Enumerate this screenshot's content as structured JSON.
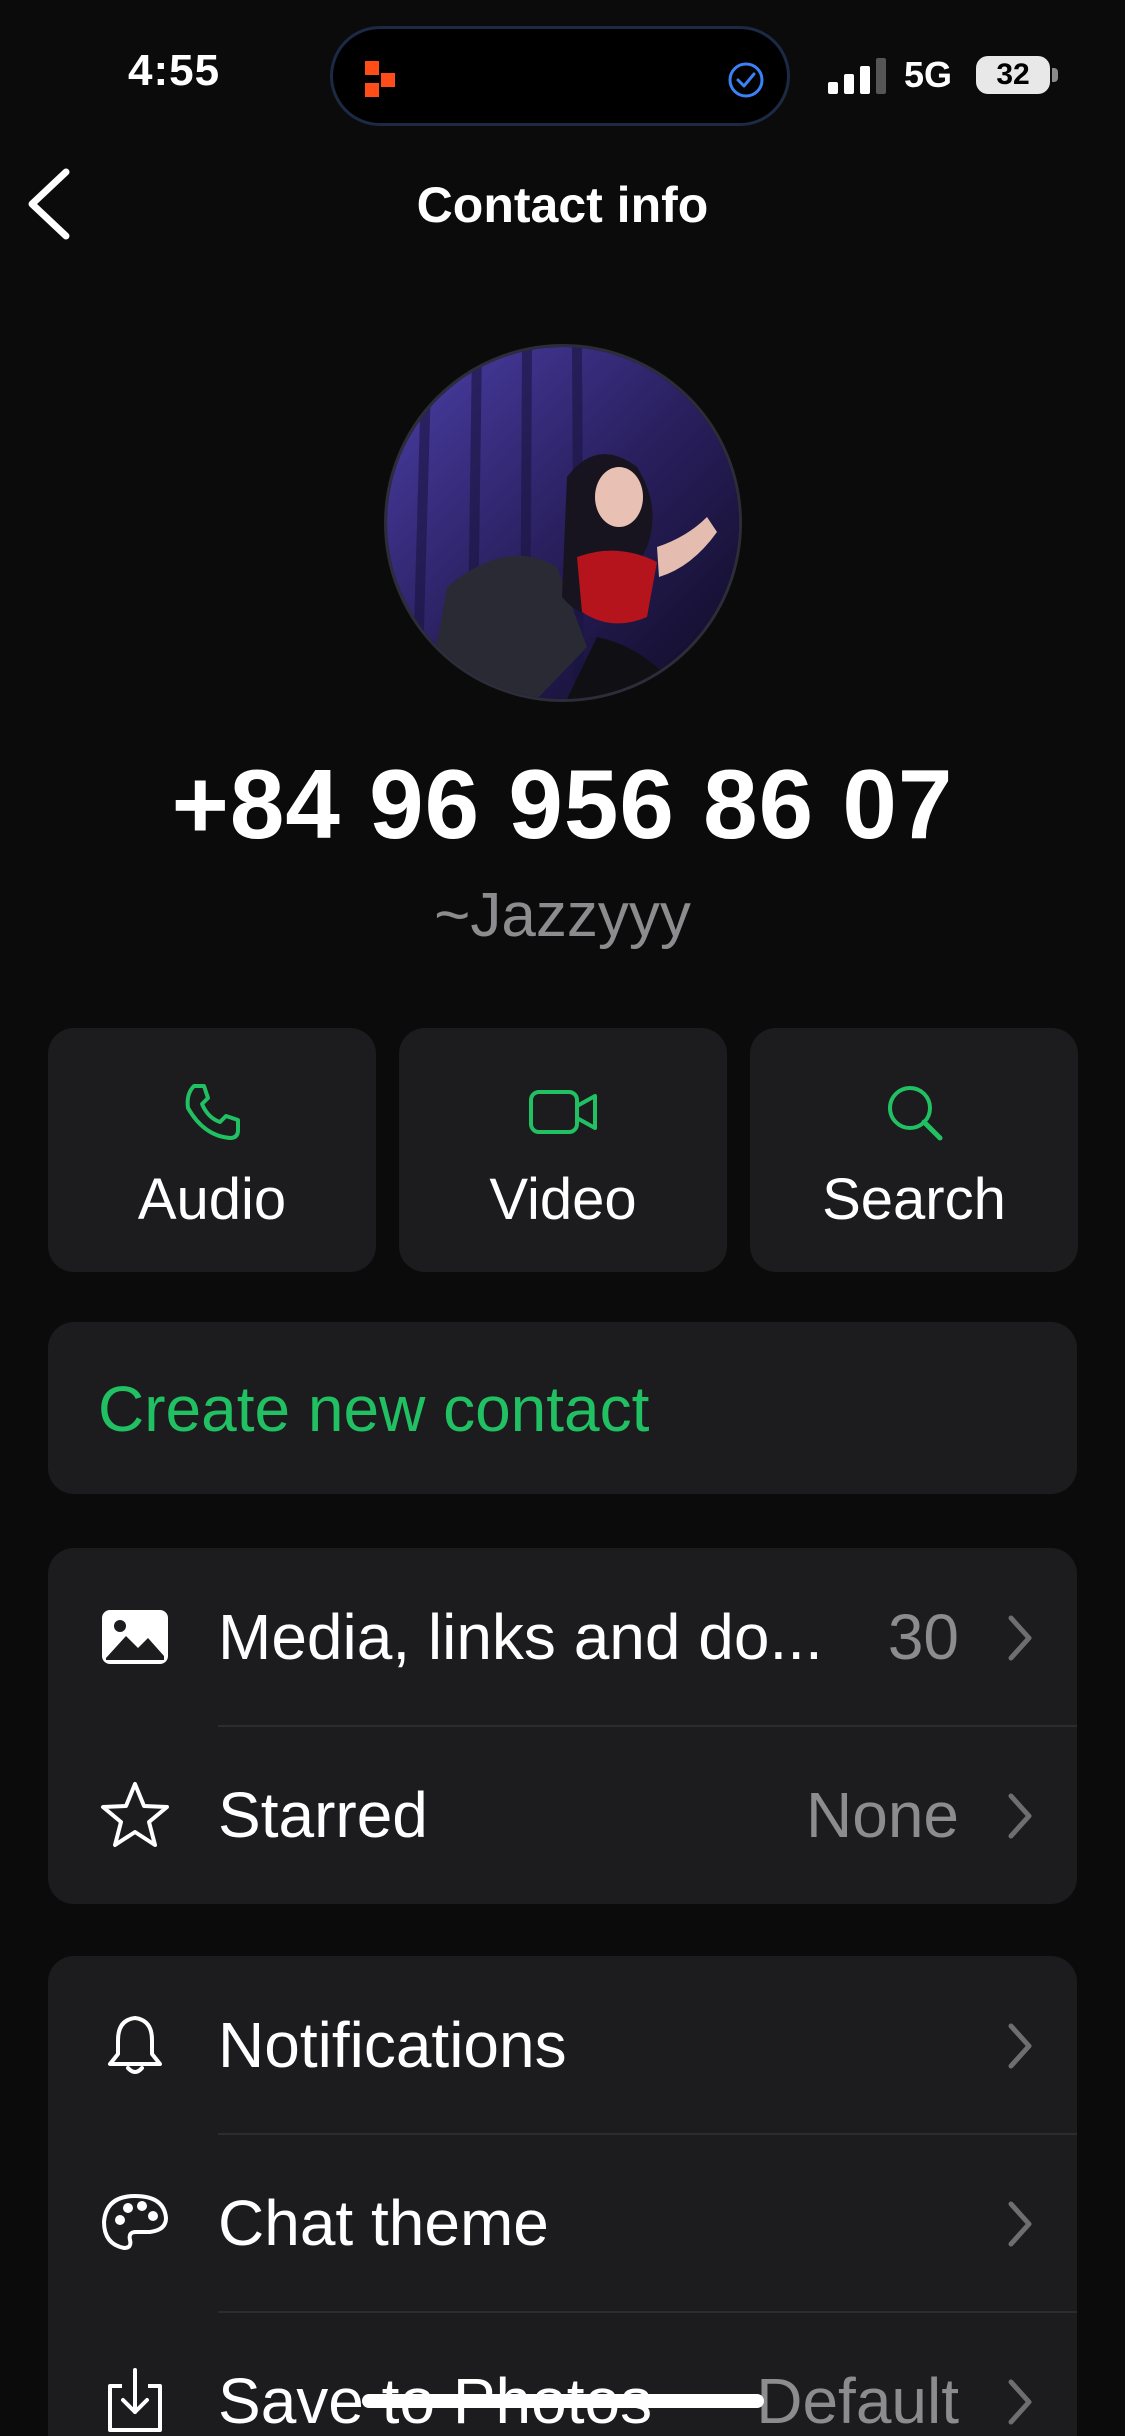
{
  "status_bar": {
    "time": "4:55",
    "network": "5G",
    "battery": "32"
  },
  "nav": {
    "title": "Contact info"
  },
  "contact": {
    "phone": "+84 96 956 86 07",
    "nickname": "~Jazzyyy"
  },
  "actions": [
    {
      "label": "Audio",
      "icon": "phone-icon"
    },
    {
      "label": "Video",
      "icon": "video-icon"
    },
    {
      "label": "Search",
      "icon": "search-icon"
    }
  ],
  "create_contact": "Create new contact",
  "media_group": [
    {
      "label": "Media, links and do...",
      "value": "30",
      "icon": "image-icon"
    },
    {
      "label": "Starred",
      "value": "None",
      "icon": "star-icon"
    }
  ],
  "settings_group": [
    {
      "label": "Notifications",
      "value": "",
      "icon": "bell-icon"
    },
    {
      "label": "Chat theme",
      "value": "",
      "icon": "palette-icon"
    },
    {
      "label": "Save to Photos",
      "value": "Default",
      "icon": "download-icon"
    }
  ],
  "colors": {
    "accent": "#21c063",
    "background": "#0b0b0c",
    "card": "#1c1c1e",
    "secondary_text": "#8c8c8e"
  }
}
